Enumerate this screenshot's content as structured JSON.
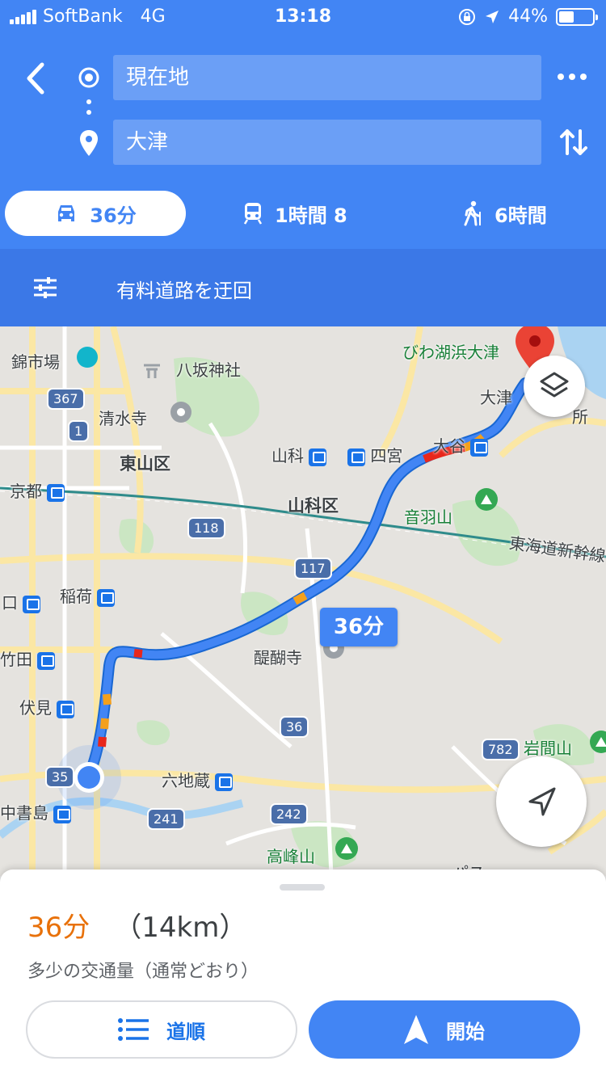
{
  "status_bar": {
    "carrier": "SoftBank",
    "network": "4G",
    "time": "13:18",
    "battery": "44%",
    "battery_level": 0.44
  },
  "directions": {
    "origin": "現在地",
    "destination": "大津",
    "icons": [
      "back-arrow-icon",
      "origin-circle-icon",
      "destination-pin-icon",
      "more-icon",
      "swap-icon"
    ]
  },
  "modes": {
    "drive": "36分",
    "transit": "1時間 8",
    "walk": "6時間"
  },
  "options": {
    "label": "有料道路を迂回"
  },
  "map": {
    "labels": {
      "nishiki": "錦市場",
      "yasaka": "八坂神社",
      "biwako_otsu": "びわ湖浜大津",
      "otsu": "大津",
      "sho": "所",
      "kiyomizu": "清水寺",
      "higashiyama": "東山区",
      "yamashina": "山科",
      "shinomiya": "四宮",
      "otani": "大谷",
      "kyoto": "京都",
      "yamashina_ku": "山科区",
      "otowayama": "音羽山",
      "shinkansen": "東海道新幹線",
      "inari": "稲荷",
      "guchi": "口",
      "daigoji": "醍醐寺",
      "takeda": "竹田",
      "fushimi": "伏見",
      "iwamayama": "岩間山",
      "rokujizo": "六地蔵",
      "nakashojima": "中書島",
      "takamineyama": "高峰山",
      "pass": "パス"
    },
    "shields": {
      "r367": "367",
      "r1": "1",
      "r118": "118",
      "r117": "117",
      "r36": "36",
      "r782": "782",
      "r35": "35",
      "r241": "241",
      "r242": "242"
    },
    "callout": "36分",
    "route_color": "#4285f4"
  },
  "summary": {
    "duration": "36分",
    "distance": "（14km）",
    "traffic": "多少の交通量（通常どおり）"
  },
  "actions": {
    "steps": "道順",
    "start": "開始"
  }
}
